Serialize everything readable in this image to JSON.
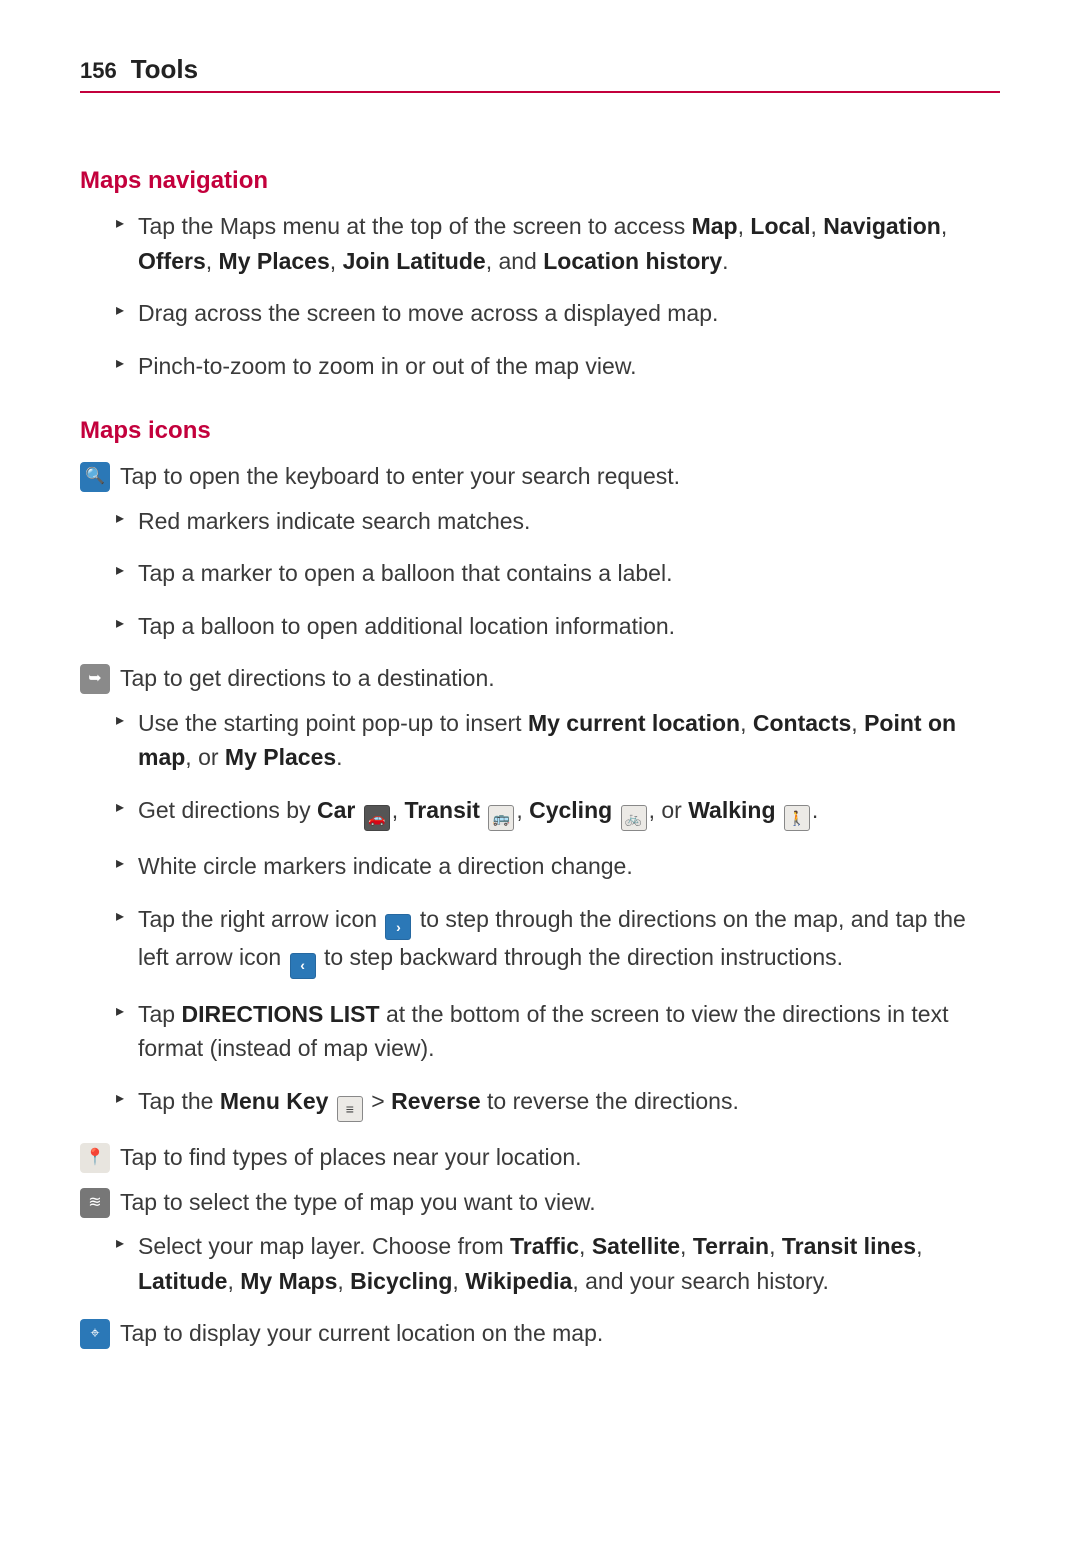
{
  "page_number": "156",
  "chapter": "Tools",
  "sections": {
    "nav": {
      "title": "Maps navigation",
      "items": [
        {
          "pre": "Tap the Maps menu at the top of the screen to access ",
          "bold": "Map",
          "c1": ", ",
          "bold2": "Local",
          "c2": ", ",
          "bold3": "Navigation",
          "c3": ", ",
          "bold4": "Offers",
          "c4": ", ",
          "bold5": "My Places",
          "c5": ", ",
          "bold6": "Join Latitude",
          "c6": ", and ",
          "bold7": "Location history",
          "c7": "."
        },
        {
          "pre": "Drag across the screen to move across a displayed map."
        },
        {
          "pre": "Pinch-to-zoom to zoom in or out of the map view."
        }
      ]
    },
    "icons": {
      "title": "Maps icons",
      "search_line": "Tap to open the keyboard to enter your search request.",
      "search_sub": [
        "Red markers indicate search matches.",
        "Tap a marker to open a balloon that contains a label.",
        "Tap a balloon to open additional location information."
      ],
      "directions_line": "Tap to get directions to a destination.",
      "directions_sub": {
        "a": {
          "pre": "Use the starting point pop-up to insert ",
          "b1": "My current location",
          "c1": ", ",
          "b2": "Contacts",
          "c2": ", ",
          "b3": "Point on map",
          "c3": ", or ",
          "b4": "My Places",
          "c4": "."
        },
        "b": {
          "pre": "Get directions by ",
          "b1": "Car",
          "c1": ", ",
          "b2": "Transit",
          "c2": ", ",
          "b3": "Cycling",
          "c3": ", or ",
          "b4": "Walking",
          "c4": "."
        },
        "c": "White circle markers indicate a direction change.",
        "d": {
          "pre": "Tap the right arrow icon ",
          "mid": " to step through the directions on the map, and tap the left arrow icon ",
          "post": " to step backward through the direction instructions."
        },
        "e": {
          "pre": "Tap ",
          "b1": "DIRECTIONS LIST",
          "post": " at the bottom of the screen to view the directions in text format (instead of map view)."
        },
        "f": {
          "pre": "Tap the ",
          "b1": "Menu Key",
          "mid": " > ",
          "b2": "Reverse",
          "post": " to reverse the directions."
        }
      },
      "places_line": "Tap to find types of places near your location.",
      "layers_line": "Tap to select the type of map you want to view.",
      "layers_sub": {
        "pre": "Select your map layer. Choose from ",
        "b1": "Traffic",
        "c1": ", ",
        "b2": "Satellite",
        "c2": ", ",
        "b3": "Terrain",
        "c3": ", ",
        "b4": "Transit lines",
        "c4": ", ",
        "b5": "Latitude",
        "c5": ", ",
        "b6": "My Maps",
        "c6": ", ",
        "b7": "Bicycling",
        "c7": ", ",
        "b8": "Wikipedia",
        "post": ", and your search history."
      },
      "location_line": "Tap to display your current location on the map."
    }
  }
}
